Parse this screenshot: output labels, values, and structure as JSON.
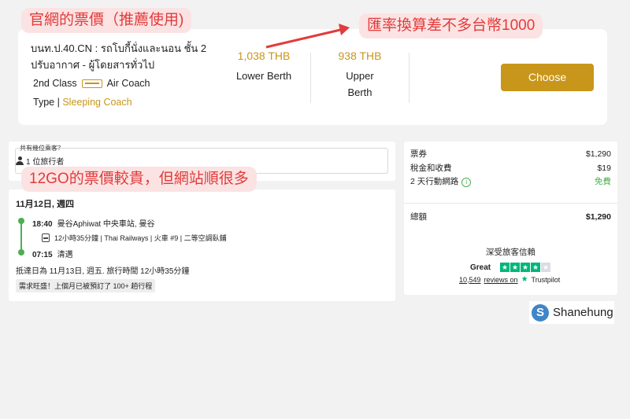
{
  "annotations": {
    "official_price": "官網的票價（推薦使用)",
    "exchange_note": "匯率換算差不多台幣1000",
    "twelvego_note": "12GO的票價較貴，但網站順很多"
  },
  "train_card": {
    "train_name": "บนท.ป.40.CN : รถโบกี้นั่งและนอน ชั้น 2 ปรับอากาศ - ผู้โดยสารทั่วไป",
    "class_label": "2nd Class",
    "coach_label": "Air Coach",
    "type_label": "Type",
    "type_value": "Sleeping Coach",
    "lower_price": "1,038 THB",
    "lower_name": "Lower Berth",
    "upper_price": "938 THB",
    "upper_name_1": "Upper",
    "upper_name_2": "Berth",
    "choose_label": "Choose"
  },
  "passengers": {
    "label": "共有幾位乘客？",
    "value": "1 位旅行者"
  },
  "trip": {
    "date": "11月12日, 週四",
    "depart_time": "18:40",
    "depart_station": "曼谷Aphiwat 中央車站, 曼谷",
    "details": "12小時35分鐘 | Thai Railways | 火車 #9 | 二等空調臥鋪",
    "arrive_time": "07:15",
    "arrive_station": "清邁",
    "arrival_summary": "抵達日為 11月13日, 週五. 旅行時間 12小時35分鐘",
    "demand_badge": "需求旺盛！上個月已被預訂了 100+ 趟行程"
  },
  "pricing": {
    "ticket_label": "票券",
    "ticket_value": "$1,290",
    "tax_label": "稅金和收費",
    "tax_value": "$19",
    "network_label": "2 天行動網路",
    "network_value": "免費",
    "total_label": "總額",
    "total_value": "$1,290",
    "trust_title": "深受旅客信賴",
    "rating_word": "Great",
    "rating_stars": 4,
    "review_count": "10,549",
    "reviews_text": "reviews on",
    "trustpilot": "Trustpilot"
  },
  "brand": {
    "logo_letter": "S",
    "name": "Shanehung"
  },
  "colors": {
    "accent": "#c8961a",
    "note_red": "#e23b3b",
    "note_bg": "#fbe3e3",
    "green": "#4caf50",
    "trustpilot_green": "#00b67a"
  }
}
